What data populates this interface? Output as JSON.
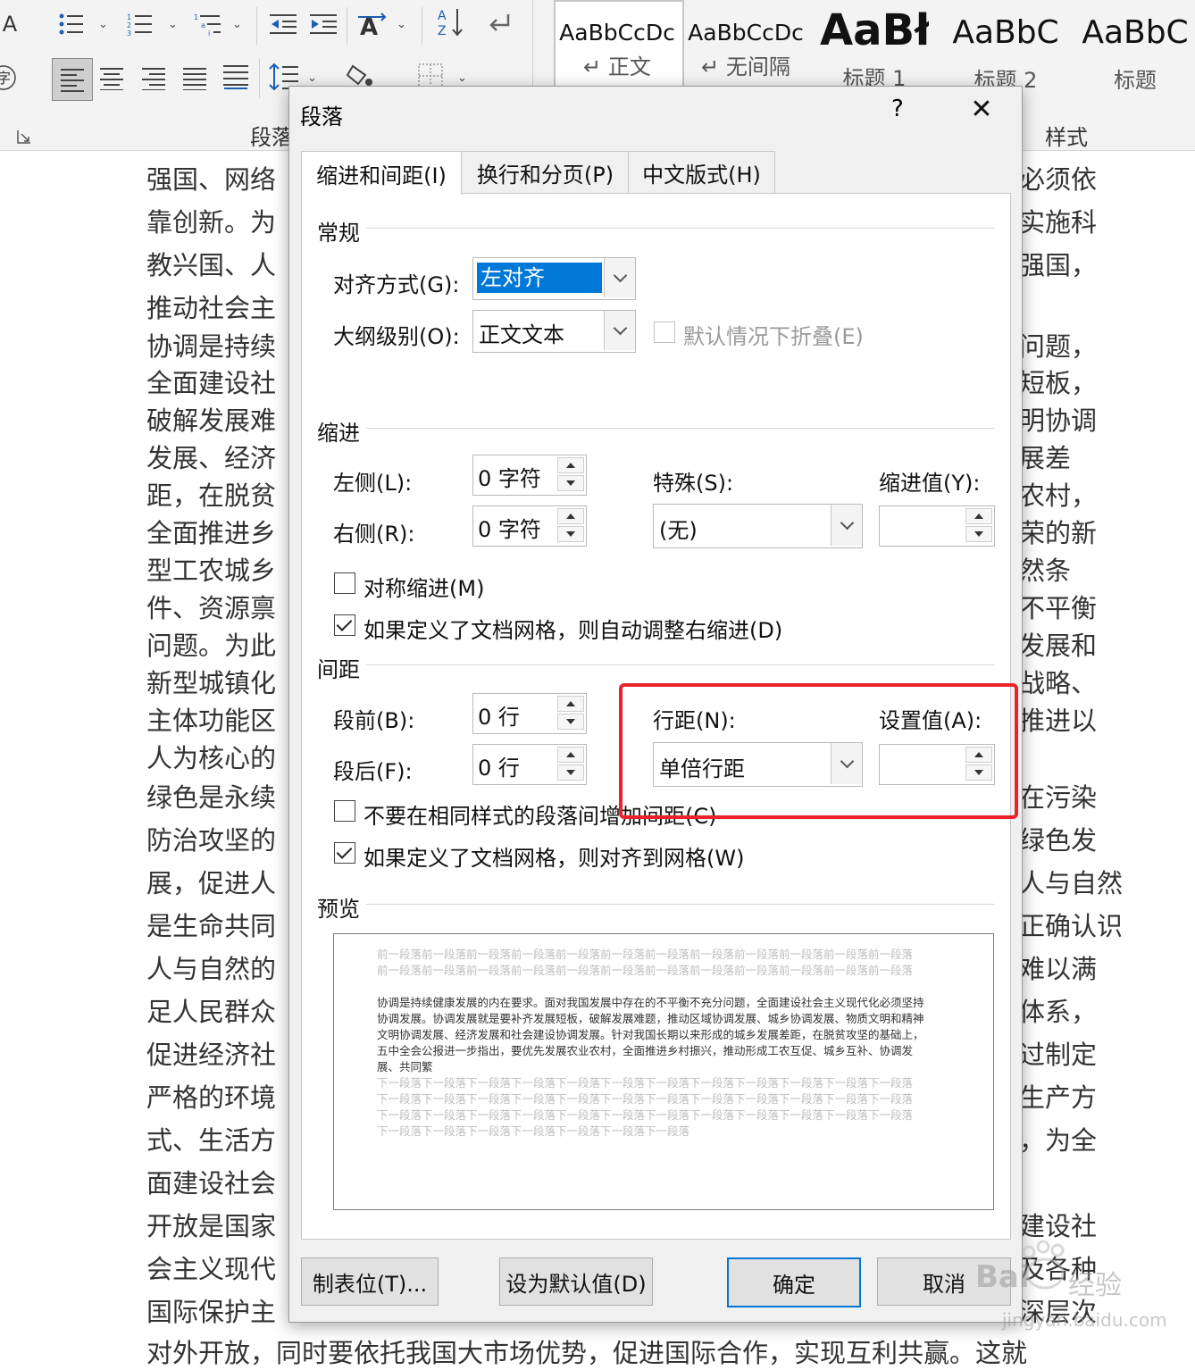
{
  "ribbon": {
    "group_paragraph_label": "段落",
    "group_styles_label": "样式",
    "styles": [
      {
        "sample": "AaBbCcDc",
        "name": "↵ 正文"
      },
      {
        "sample": "AaBbCcDc",
        "name": "↵ 无间隔"
      },
      {
        "sample": "AaBł",
        "name": "标题 1"
      },
      {
        "sample": "AaBbC",
        "name": "标题 2"
      },
      {
        "sample": "AaBbC",
        "name": "标题"
      }
    ]
  },
  "doc": {
    "left_lines": [
      "强国、网络",
      "靠创新。为",
      "教兴国、人",
      "推动社会主",
      "协调是持续",
      "全面建设社",
      "破解发展难",
      "发展、经济",
      "距，在脱贫",
      "全面推进乡",
      "型工农城乡",
      "件、资源禀",
      "问题。为此",
      "新型城镇化",
      "主体功能区",
      "人为核心的",
      "绿色是永续",
      "防治攻坚的",
      "展，促进人",
      "是生命共同",
      "人与自然的",
      "足人民群众",
      "促进经济社",
      "严格的环境",
      "式、生活方",
      "面建设社会",
      "开放是国家",
      "会主义现代",
      "国际保护主"
    ],
    "right_lines": [
      "必须依",
      "实施科",
      "强国，",
      "",
      "问题，",
      "短板，",
      "明协调",
      "展差",
      "农村，",
      "荣的新",
      "然条",
      "不平衡",
      "发展和",
      "战略、",
      "推进以",
      "",
      "在污染",
      "绿色发",
      "人与自然",
      "正确认识",
      "难以满",
      "体系，",
      "过制定",
      "生产方",
      "，为全",
      "",
      "建设社",
      "及各种",
      "深层次"
    ],
    "last_line": "对外开放，同时要依托我国大市场优势，促进国际合作，实现互利共赢。这就"
  },
  "dialog": {
    "title": "段落",
    "help": "?",
    "close": "✕",
    "tabs": [
      "缩进和间距(I)",
      "换行和分页(P)",
      "中文版式(H)"
    ],
    "general": {
      "section": "常规",
      "alignment_label": "对齐方式(G):",
      "alignment_value": "左对齐",
      "outline_label": "大纲级别(O):",
      "outline_value": "正文文本",
      "collapse_label": "默认情况下折叠(E)"
    },
    "indent": {
      "section": "缩进",
      "left_label": "左侧(L):",
      "left_value": "0 字符",
      "right_label": "右侧(R):",
      "right_value": "0 字符",
      "special_label": "特殊(S):",
      "special_value": "(无)",
      "by_label": "缩进值(Y):",
      "by_value": "",
      "mirror_label": "对称缩进(M)",
      "auto_right_label": "如果定义了文档网格，则自动调整右缩进(D)"
    },
    "spacing": {
      "section": "间距",
      "before_label": "段前(B):",
      "before_value": "0 行",
      "after_label": "段后(F):",
      "after_value": "0 行",
      "line_label": "行距(N):",
      "line_value": "单倍行距",
      "at_label": "设置值(A):",
      "at_value": "",
      "no_space_label": "不要在相同样式的段落间增加间距(C)",
      "snap_grid_label": "如果定义了文档网格，则对齐到网格(W)"
    },
    "preview": {
      "section": "预览",
      "prev_text": "前一段落前一段落前一段落前一段落前一段落前一段落前一段落前一段落前一段落前一段落前一段落前一段落前一段落前一段落前一段落前一段落前一段落前一段落前一段落前一段落前一段落前一段落前一段落前一段落",
      "main_text": "协调是持续健康发展的内在要求。面对我国发展中存在的不平衡不充分问题，全面建设社会主义现代化必须坚持协调发展。协调发展就是要补齐发展短板，破解发展难题，推动区域协调发展、城乡协调发展、物质文明和精神文明协调发展、经济发展和社会建设协调发展。针对我国长期以来形成的城乡发展差距，在脱贫攻坚的基础上，五中全会公报进一步指出，要优先发展农业农村，全面推进乡村振兴，推动形成工农互促、城乡互补、协调发展、共同繁",
      "next_text": "下一段落下一段落下一段落下一段落下一段落下一段落下一段落下一段落下一段落下一段落下一段落下一段落下一段落下一段落下一段落下一段落下一段落下一段落下一段落下一段落下一段落下一段落下一段落下一段落下一段落下一段落下一段落下一段落下一段落下一段落下一段落下一段落下一段落下一段落下一段落下一段落下一段落下一段落下一段落下一段落下一段落下一段落下一段落"
    },
    "buttons": {
      "tabs": "制表位(T)...",
      "default": "设为默认值(D)",
      "ok": "确定",
      "cancel": "取消"
    }
  },
  "watermark": {
    "brand": "Bai",
    "sub": "经验",
    "url": "jingyan.baidu.com"
  },
  "colors": {
    "accent": "#0078d7",
    "highlight": "#e8232a"
  }
}
